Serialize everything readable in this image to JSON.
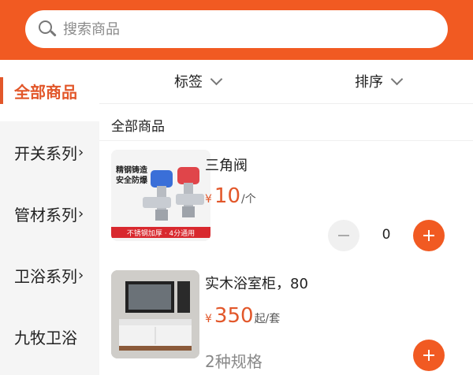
{
  "search": {
    "placeholder": "搜索商品"
  },
  "sidebar": {
    "items": [
      {
        "label": "全部商品",
        "chevron": ""
      },
      {
        "label": "开关系列",
        "chevron": "›"
      },
      {
        "label": "管材系列",
        "chevron": "›"
      },
      {
        "label": "卫浴系列",
        "chevron": "›"
      },
      {
        "label": "九牧卫浴",
        "chevron": ""
      }
    ]
  },
  "filters": {
    "tag_label": "标签",
    "sort_label": "排序"
  },
  "section_title": "全部商品",
  "products": [
    {
      "name": "三角阀",
      "currency": "¥",
      "price": "10",
      "unit": "/个",
      "quantity": "0",
      "image_text": {
        "line1": "精钢铸造",
        "line2": "安全防爆",
        "banner": "不锈钢加厚 · 4分通用"
      }
    },
    {
      "name": "实木浴室柜，80",
      "currency": "¥",
      "price": "350",
      "unit": "起/套",
      "spec_text": "2种规格"
    }
  ],
  "colors": {
    "accent": "#f15a22",
    "price": "#e2572a",
    "sidebar_bg": "#f5f5f5"
  },
  "icons": [
    "search-icon",
    "chevron-right-icon",
    "chevron-down-icon",
    "minus-icon",
    "plus-icon"
  ]
}
